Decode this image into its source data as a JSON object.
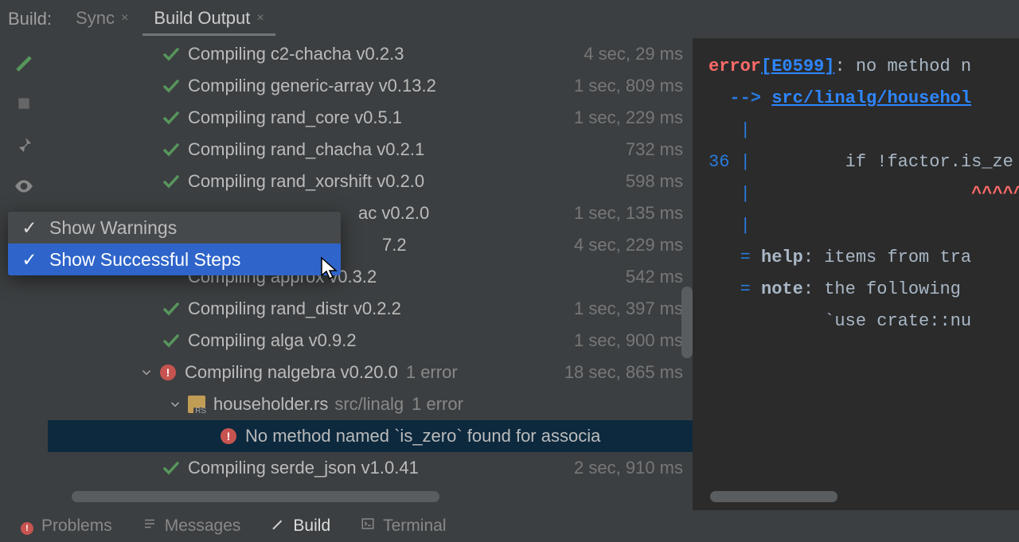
{
  "header": {
    "label": "Build:",
    "tabs": [
      {
        "label": "Sync",
        "active": false
      },
      {
        "label": "Build Output",
        "active": true
      }
    ]
  },
  "tasks": [
    {
      "name": "Compiling c2-chacha v0.2.3",
      "duration": "4 sec, 29 ms",
      "status": "ok"
    },
    {
      "name": "Compiling generic-array v0.13.2",
      "duration": "1 sec, 809 ms",
      "status": "ok"
    },
    {
      "name": "Compiling rand_core v0.5.1",
      "duration": "1 sec, 229 ms",
      "status": "ok"
    },
    {
      "name": "Compiling rand_chacha v0.2.1",
      "duration": "732 ms",
      "status": "ok"
    },
    {
      "name": "Compiling rand_xorshift v0.2.0",
      "duration": "598 ms",
      "status": "ok"
    },
    {
      "name": "ac v0.2.0",
      "duration": "1 sec, 135 ms",
      "status": "ok",
      "partial": true
    },
    {
      "name": "7.2",
      "duration": "4 sec, 229 ms",
      "status": "ok",
      "partial": true
    },
    {
      "name": "Compiling approx v0.3.2",
      "duration": "542 ms",
      "status": "ok",
      "underpopup": true
    },
    {
      "name": "Compiling rand_distr v0.2.2",
      "duration": "1 sec, 397 ms",
      "status": "ok"
    },
    {
      "name": "Compiling alga v0.9.2",
      "duration": "1 sec, 900 ms",
      "status": "ok"
    }
  ],
  "error_branch": {
    "name": "Compiling nalgebra v0.20.0",
    "badge": "1 error",
    "duration": "18 sec, 865 ms",
    "file": {
      "name": "householder.rs",
      "path": "src/linalg",
      "badge": "1 error"
    },
    "message": "No method named `is_zero` found for associa"
  },
  "after_task": {
    "name": "Compiling serde_json v1.0.41",
    "duration": "2 sec, 910 ms"
  },
  "popup": {
    "items": [
      {
        "label": "Show Warnings",
        "selected": false,
        "checked": true
      },
      {
        "label": "Show Successful Steps",
        "selected": true,
        "checked": true
      }
    ]
  },
  "code": {
    "err_word": "error",
    "err_code": "[E0599]",
    "err_tail": ": no method n",
    "arrow": "-->",
    "file_link": "src/linalg/househol",
    "ln": "36",
    "code_line": "if !factor.is_ze",
    "carets": "^^^^^",
    "help_label": "help",
    "help_tail": ": items from tra",
    "note_label": "note",
    "note_tail": ": the following ",
    "use_line": "`use crate::nu"
  },
  "bottom": {
    "items": [
      {
        "label": "Problems",
        "icon": "error"
      },
      {
        "label": "Messages",
        "icon": "list"
      },
      {
        "label": "Build",
        "icon": "hammer",
        "active": true
      },
      {
        "label": "Terminal",
        "icon": "terminal"
      }
    ]
  }
}
